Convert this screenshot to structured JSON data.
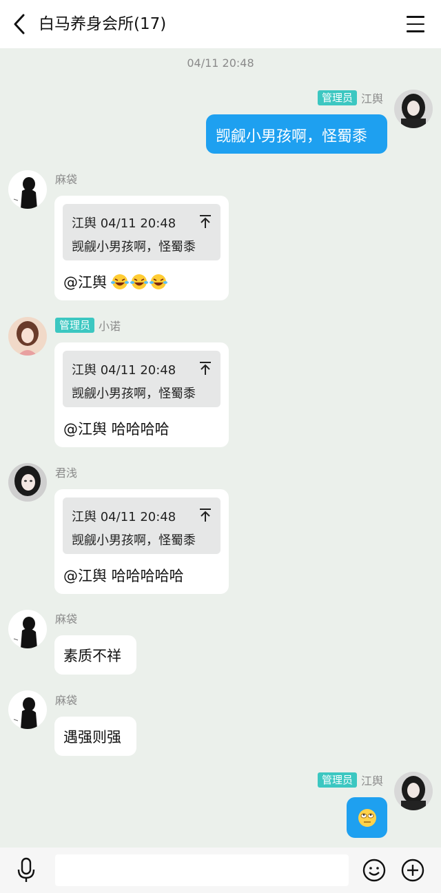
{
  "header": {
    "title": "白马养身会所(17)",
    "back_icon": "chevron-left-icon",
    "menu_icon": "hamburger-menu-icon"
  },
  "timestamp": "04/11 20:48",
  "colors": {
    "self_bubble": "#1ea0f0",
    "badge": "#3cc7c1",
    "background": "#ebf0eb"
  },
  "messages": [
    {
      "side": "right",
      "badge": "管理员",
      "sender": "江舆",
      "text": "觊觎小男孩啊，怪蜀黍"
    },
    {
      "side": "left",
      "sender": "麻袋",
      "quote": {
        "author_time": "江舆 04/11 20:48",
        "text": "觊觎小男孩啊，怪蜀黍"
      },
      "reply": "@江舆",
      "emoji": "laughing-tears-emoji x3"
    },
    {
      "side": "left",
      "badge": "管理员",
      "sender": "小诺",
      "quote": {
        "author_time": "江舆 04/11 20:48",
        "text": "觊觎小男孩啊，怪蜀黍"
      },
      "reply": "@江舆 哈哈哈哈"
    },
    {
      "side": "left",
      "sender": "君浅",
      "quote": {
        "author_time": "江舆 04/11 20:48",
        "text": "觊觎小男孩啊，怪蜀黍"
      },
      "reply": "@江舆 哈哈哈哈哈"
    },
    {
      "side": "left",
      "sender": "麻袋",
      "text": "素质不祥"
    },
    {
      "side": "left",
      "sender": "麻袋",
      "text": "遇强则强"
    },
    {
      "side": "right",
      "badge": "管理员",
      "sender": "江舆",
      "emoji": "rolling-eyes-emoji"
    }
  ],
  "input_bar": {
    "placeholder": "",
    "mic_icon": "microphone-icon",
    "emoji_icon": "smiley-icon",
    "plus_icon": "plus-circle-icon"
  }
}
